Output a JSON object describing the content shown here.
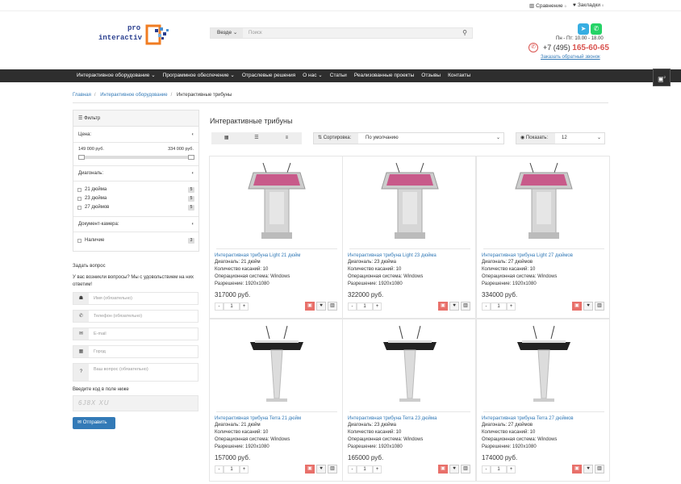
{
  "topbar": {
    "compare": "Сравнение",
    "compare_count": "0",
    "bookmarks": "Закладки",
    "bookmarks_count": "0"
  },
  "logo": {
    "line1": "pro",
    "line2": "interactiv"
  },
  "search": {
    "scope": "Везде",
    "placeholder": "Поиск"
  },
  "contact": {
    "hours": "Пн - Пт: 10.00 - 18.00",
    "phone_prefix": "+7 (495)",
    "phone_number": "165-60-65",
    "callback": "Заказать обратный звонок"
  },
  "nav": [
    "Интерактивное оборудование",
    "Программное обеспечение",
    "Отраслевые решения",
    "О нас",
    "Статьи",
    "Реализованные проекты",
    "Отзывы",
    "Контакты"
  ],
  "cart": {
    "count": "2"
  },
  "breadcrumb": [
    "Главная",
    "Интерактивное оборудование",
    "Интерактивные трибуны"
  ],
  "filter": {
    "title": "Фильтр",
    "price_label": "Цена:",
    "price_min": "149 000 руб.",
    "price_max": "334 000 руб.",
    "diag_label": "Диагональ:",
    "diag_items": [
      {
        "label": "21 дюйма",
        "count": "5"
      },
      {
        "label": "23 дюйма",
        "count": "5"
      },
      {
        "label": "27 дюймов",
        "count": "5"
      }
    ],
    "cam_label": "Документ-камера:",
    "cam_items": [
      {
        "label": "Наличие",
        "count": "3"
      }
    ]
  },
  "ask": {
    "title": "Задать вопрос",
    "text": "У вас возникли вопросы? Мы с удовольствием на них ответим!",
    "name_ph": "Имя (обязательно)",
    "phone_ph": "Телефон (обязательно)",
    "email_ph": "E-mail",
    "city_ph": "Город",
    "question_ph": "Ваш вопрос (обязательно)",
    "captcha_label": "Введите код в поле ниже",
    "captcha": "6J8X XU",
    "send": "Отправить"
  },
  "catalog": {
    "title": "Интерактивные трибуны",
    "sort_label": "Сортировка:",
    "sort_value": "По умолчанию",
    "show_label": "Показать:",
    "show_value": "12"
  },
  "products": [
    {
      "name": "Интерактивная трибуна Light 21 дюйм",
      "diag": "Диагональ:  21 дюйм",
      "touch": "Количество касаний:  10",
      "os": "Операционная система:  Windows",
      "res": "Разрешение:  1920x1080",
      "price": "317000 руб.",
      "qty": "1"
    },
    {
      "name": "Интерактивная трибуна Light 23 дюйма",
      "diag": "Диагональ:  23 дюйма",
      "touch": "Количество касаний:  10",
      "os": "Операционная система:  Windows",
      "res": "Разрешение:  1920x1080",
      "price": "322000 руб.",
      "qty": "1"
    },
    {
      "name": "Интерактивная трибуна Light 27 дюймов",
      "diag": "Диагональ:  27 дюймов",
      "touch": "Количество касаний:  10",
      "os": "Операционная система:  Windows",
      "res": "Разрешение:  1920x1080",
      "price": "334000 руб.",
      "qty": "1"
    },
    {
      "name": "Интерактивная трибуна Terra 21 дюйм",
      "diag": "Диагональ:  21 дюйм",
      "touch": "Количество касаний:  10",
      "os": "Операционная система:  Windows",
      "res": "Разрешение:  1920x1080",
      "price": "157000 руб.",
      "qty": "1"
    },
    {
      "name": "Интерактивная трибуна Terra 23 дюйма",
      "diag": "Диагональ:  23 дюйма",
      "touch": "Количество касаний:  10",
      "os": "Операционная система:  Windows",
      "res": "Разрешение:  1920x1080",
      "price": "165000 руб.",
      "qty": "1"
    },
    {
      "name": "Интерактивная трибуна Terra 27 дюймов",
      "diag": "Диагональ:  27 дюймов",
      "touch": "Количество касаний:  10",
      "os": "Операционная система:  Windows",
      "res": "Разрешение:  1920x1080",
      "price": "174000 руб.",
      "qty": "1"
    }
  ]
}
